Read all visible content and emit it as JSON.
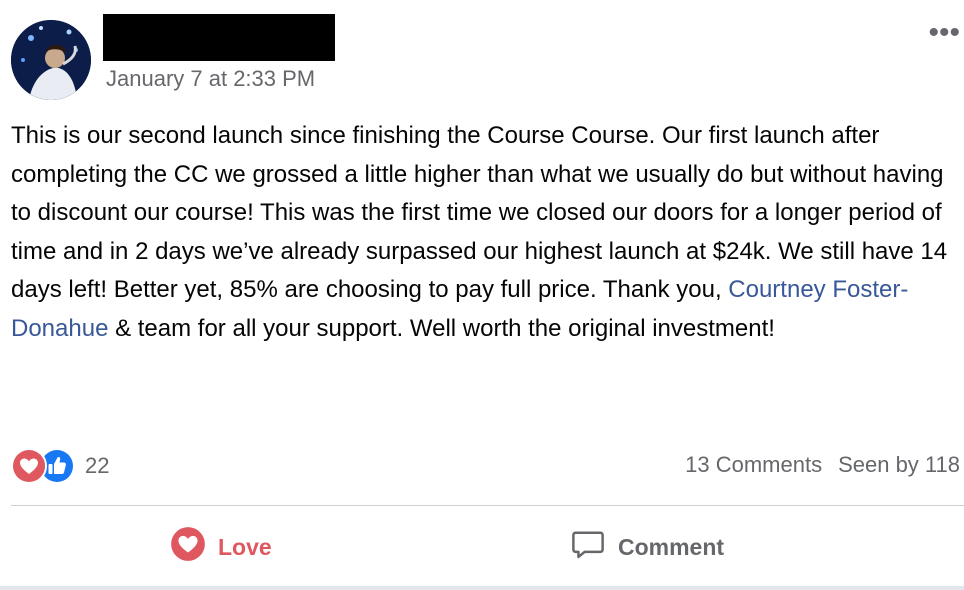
{
  "post": {
    "author_name": "",
    "timestamp": "January 7 at 2:33 PM",
    "text_before_mention": "This is our second launch since finishing the Course Course. Our first launch after completing the CC we grossed a little higher than what we usually do but without having to discount our course! This was the first time we closed our doors for a longer period of time and in 2 days we’ve already surpassed our highest launch at $24k. We still have 14 days left! Better yet, 85% are choosing to pay full price. Thank you, ",
    "mention": "Courtney Foster-Donahue",
    "text_after_mention": " & team for all your support. Well worth the original investment!",
    "more_icon": "•••"
  },
  "reactions": {
    "icons": [
      "love-reaction-icon",
      "like-reaction-icon"
    ],
    "count": "22"
  },
  "stats": {
    "comments": "13 Comments",
    "seen": "Seen by 118"
  },
  "actions": {
    "love_label": "Love",
    "comment_label": "Comment"
  },
  "colors": {
    "love": "#e0585f",
    "like": "#1877f2",
    "mention": "#385898",
    "secondary_text": "#65676b"
  }
}
